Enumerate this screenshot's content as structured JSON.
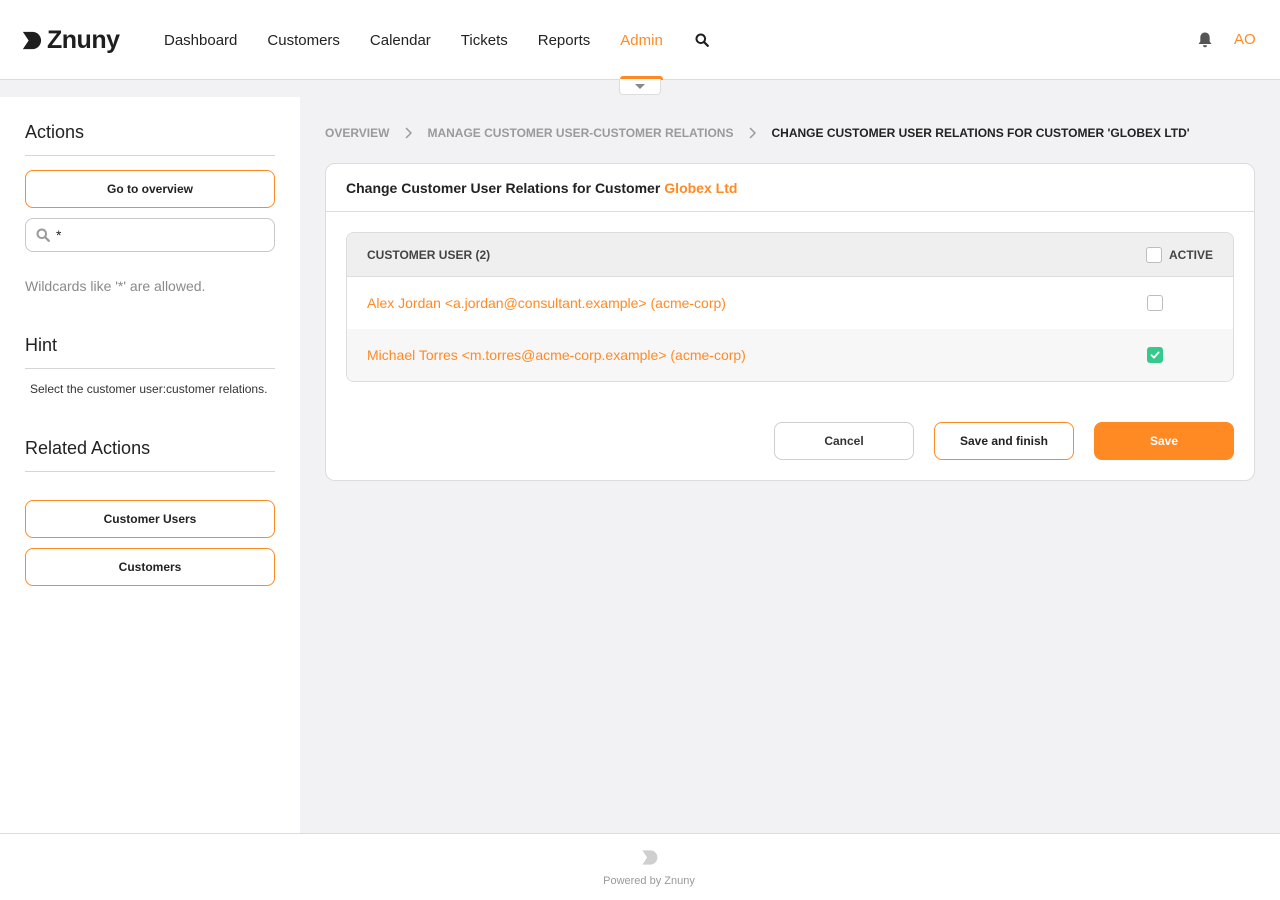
{
  "app": {
    "logo_text": "Znuny",
    "colors": {
      "accent": "#ff8a24",
      "success": "#35c98c"
    }
  },
  "nav": {
    "items": [
      {
        "label": "Dashboard"
      },
      {
        "label": "Customers"
      },
      {
        "label": "Calendar"
      },
      {
        "label": "Tickets"
      },
      {
        "label": "Reports"
      },
      {
        "label": "Admin",
        "active": true
      }
    ],
    "search_icon": "search-icon",
    "notifications_icon": "bell-icon",
    "user_initials": "AO"
  },
  "sidebar": {
    "actions_title": "Actions",
    "go_to_overview": "Go to overview",
    "filter_value": "*",
    "wildcard_note": "Wildcards like '*' are allowed.",
    "hint_title": "Hint",
    "hint_text": "Select the customer user:customer relations.",
    "related_title": "Related Actions",
    "related_items": [
      {
        "label": "Customer Users"
      },
      {
        "label": "Customers"
      }
    ]
  },
  "breadcrumb": [
    {
      "label": "OVERVIEW"
    },
    {
      "label": "MANAGE CUSTOMER USER-CUSTOMER RELATIONS"
    },
    {
      "label": "CHANGE CUSTOMER USER RELATIONS FOR CUSTOMER 'GLOBEX LTD'"
    }
  ],
  "card": {
    "title": "Change Customer User Relations for Customer",
    "customer_name": "Globex Ltd",
    "table": {
      "col_customer_user": "CUSTOMER USER (2)",
      "col_active": "ACTIVE",
      "header_checked": false,
      "rows": [
        {
          "label": "Alex Jordan <a.jordan@consultant.example> (acme-corp)",
          "checked": false
        },
        {
          "label": "Michael Torres <m.torres@acme-corp.example> (acme-corp)",
          "checked": true
        }
      ]
    },
    "buttons": {
      "cancel": "Cancel",
      "save_and_finish": "Save and finish",
      "save": "Save"
    }
  },
  "footer": {
    "powered_by": "Powered by",
    "brand": "Znuny"
  }
}
